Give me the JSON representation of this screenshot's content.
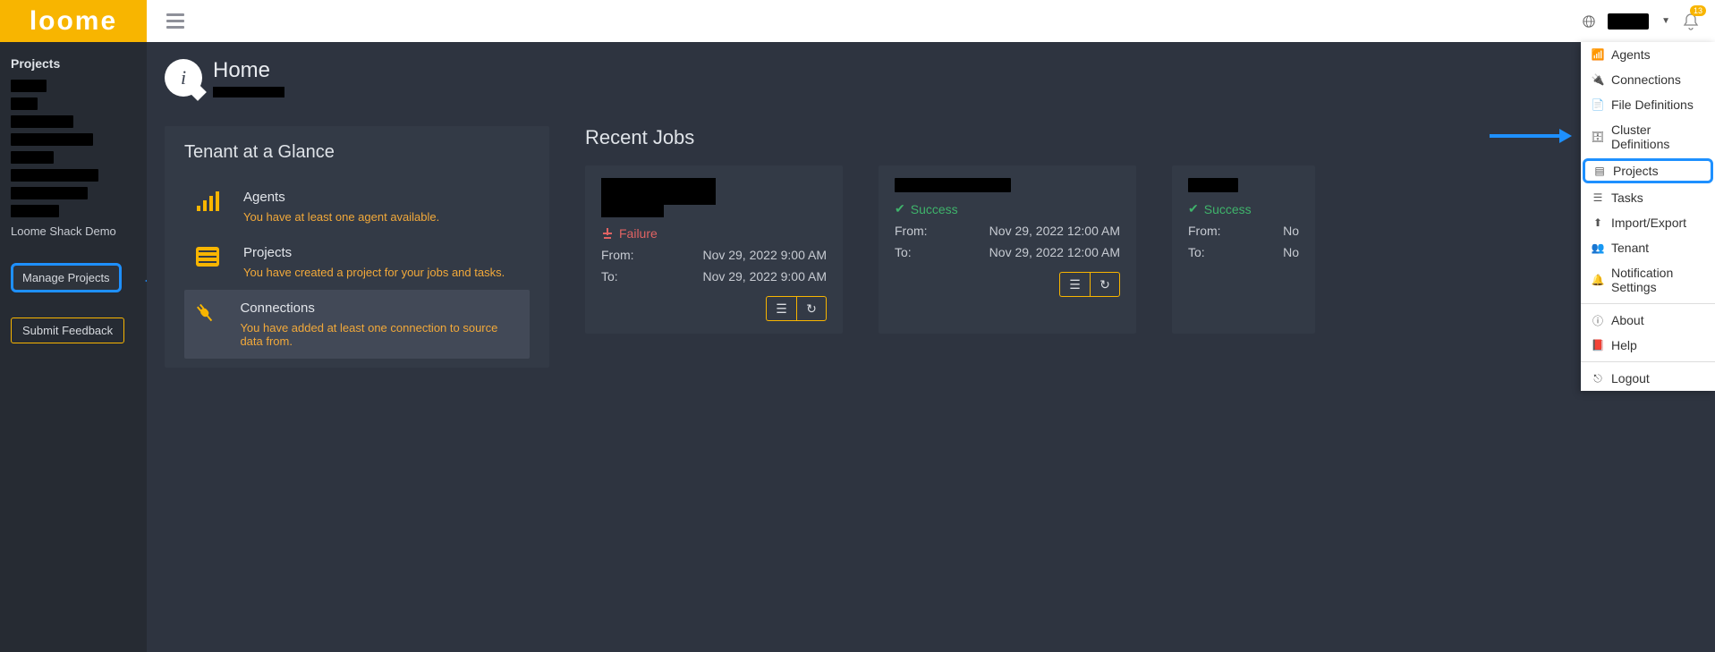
{
  "header": {
    "logo_text": "loome",
    "notif_count": "13"
  },
  "sidebar": {
    "section": "Projects",
    "named_project": "Loome Shack Demo",
    "manage_label": "Manage Projects",
    "feedback_label": "Submit Feedback"
  },
  "page": {
    "title": "Home"
  },
  "glance": {
    "heading": "Tenant at a Glance",
    "rows": [
      {
        "title": "Agents",
        "desc": "You have at least one agent available."
      },
      {
        "title": "Projects",
        "desc": "You have created a project for your jobs and tasks."
      },
      {
        "title": "Connections",
        "desc": "You have added at least one connection to source data from."
      }
    ]
  },
  "recent": {
    "heading": "Recent Jobs",
    "labels": {
      "from": "From:",
      "to": "To:"
    },
    "cards": [
      {
        "status": "Failure",
        "status_class": "fail",
        "from": "Nov 29, 2022 9:00 AM",
        "to": "Nov 29, 2022 9:00 AM"
      },
      {
        "status": "Success",
        "status_class": "ok",
        "from": "Nov 29, 2022 12:00 AM",
        "to": "Nov 29, 2022 12:00 AM"
      },
      {
        "status": "Success",
        "status_class": "ok",
        "from": "No",
        "to": "No"
      }
    ]
  },
  "dropdown": {
    "items1": [
      "Agents",
      "Connections",
      "File Definitions",
      "Cluster Definitions",
      "Projects",
      "Tasks",
      "Import/Export",
      "Tenant",
      "Notification Settings"
    ],
    "items2": [
      "About",
      "Help"
    ],
    "items3": [
      "Logout"
    ]
  }
}
